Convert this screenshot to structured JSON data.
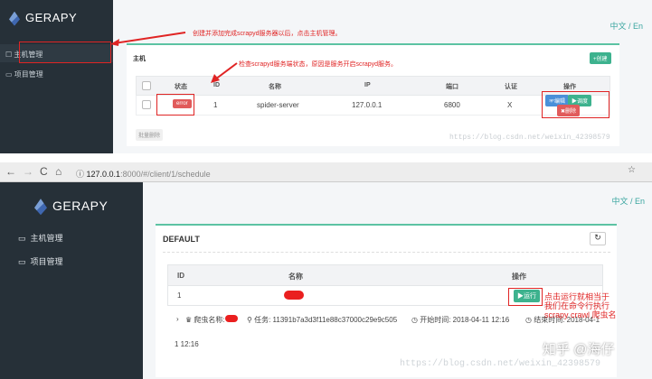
{
  "screenshot_top": {
    "app": {
      "title": "GERAPY",
      "lang_switch": "中文 / En"
    },
    "sidebar": {
      "items": [
        {
          "label": "主机管理"
        },
        {
          "label": "项目管理"
        }
      ]
    },
    "card": {
      "title": "主机",
      "create_label": "+创建"
    },
    "table": {
      "columns": [
        "状态",
        "ID",
        "名称",
        "IP",
        "端口",
        "认证",
        "操作"
      ],
      "rows": [
        {
          "status": "error",
          "id": "1",
          "name": "spider-server",
          "ip": "127.0.0.1",
          "port": "6800",
          "auth": "X"
        }
      ],
      "actions": {
        "edit": "☞编辑",
        "schedule": "▶调度",
        "delete": "✖删除"
      }
    },
    "batch_delete": "批量删除",
    "annotations": {
      "create": "创建并添加完成scrapyd服务器以后，点击主机管理。",
      "status": "检查scrapyd服务端状态，原因是服务开启scrapyd服务。"
    },
    "watermark": "https://blog.csdn.net/weixin_42398579"
  },
  "screenshot_bottom": {
    "browser": {
      "url": "127.0.0.1:8000/#/client/1/schedule",
      "url_host": "127.0.0.1",
      "url_rest": ":8000/#/client/1/schedule"
    },
    "app": {
      "title": "GERAPY",
      "lang_switch": "中文 / En"
    },
    "sidebar": {
      "items": [
        {
          "label": "主机管理"
        },
        {
          "label": "项目管理"
        }
      ]
    },
    "card": {
      "title": "DEFAULT",
      "refresh_icon": "refresh-icon"
    },
    "table": {
      "columns": [
        "ID",
        "名称",
        "操作"
      ],
      "rows": [
        {
          "id": "1",
          "action": "▶运行"
        }
      ]
    },
    "detail": {
      "spider_label": "爬虫名称:",
      "task": "任务: 11391b7a3d3f11e88c37000c29e9c505",
      "start": "开始时间: 2018-04-11 12:16",
      "end": "结束时间: 2018-04-1",
      "end_tail": "1 12:16"
    },
    "annotation": "点击运行就相当于我们在命令行执行scrapy crawl 爬虫名",
    "watermark": {
      "zhihu": "知乎 @海仔",
      "csdn": "https://blog.csdn.net/weixin_42398579"
    }
  }
}
